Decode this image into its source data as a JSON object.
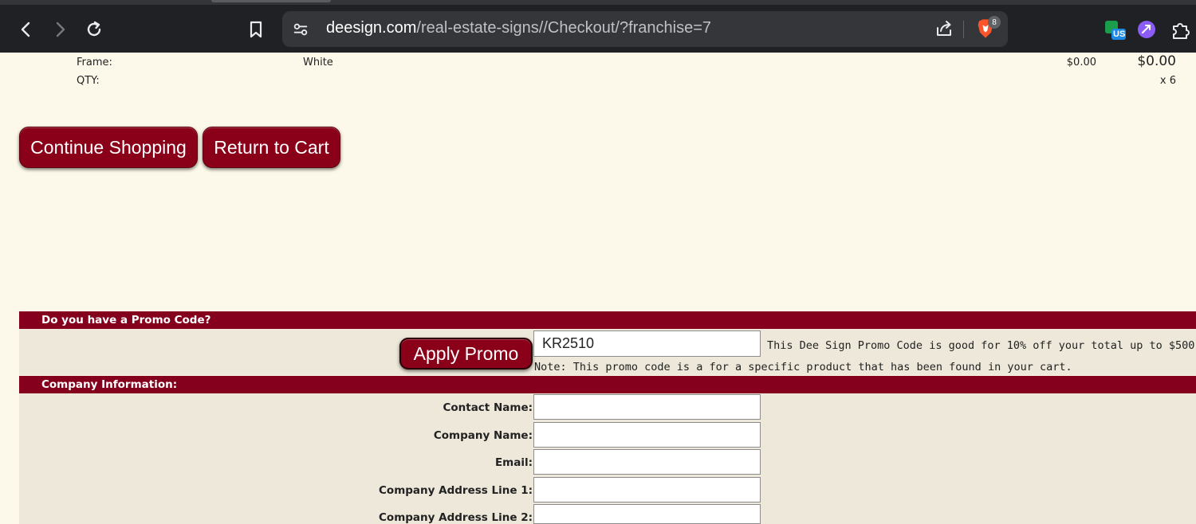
{
  "browser": {
    "url_host": "deesign.com",
    "url_path": "/real-estate-signs//Checkout/?franchise=7",
    "brave_badge": "8",
    "ext_label": "US"
  },
  "order_line": {
    "frame_label": "Frame:",
    "frame_value": "White",
    "qty_label": "QTY:",
    "unit_price": "$0.00",
    "total_price": "$0.00",
    "qty_value": "x 6"
  },
  "buttons": {
    "continue_shopping": "Continue Shopping",
    "return_to_cart": "Return to Cart",
    "apply_promo": "Apply Promo"
  },
  "promo": {
    "section_title": "Do you have a Promo Code?",
    "code_value": "KR2510",
    "description": "This Dee Sign Promo Code is good for 10% off your total up to $500.",
    "note": "Note: This promo code is a for a specific product that has been found in your cart."
  },
  "company": {
    "section_title": "Company Information:",
    "fields": [
      {
        "label": "Contact Name:",
        "value": ""
      },
      {
        "label": "Company Name:",
        "value": ""
      },
      {
        "label": "Email:",
        "value": ""
      },
      {
        "label": "Company Address Line 1:",
        "value": ""
      },
      {
        "label": "Company Address Line 2:",
        "value": ""
      }
    ]
  }
}
